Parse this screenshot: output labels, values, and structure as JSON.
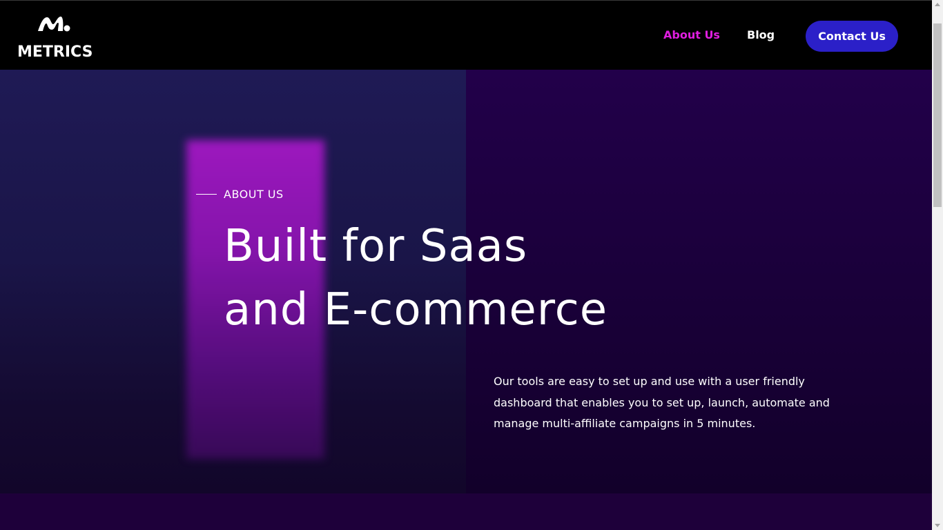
{
  "header": {
    "logo_text": "METRICS",
    "logo_icon": "metrics-logo-icon",
    "nav": {
      "about": "About Us",
      "blog": "Blog",
      "contact": "Contact Us"
    }
  },
  "hero": {
    "eyebrow": "ABOUT US",
    "headline_line1": "Built for Saas",
    "headline_line2": "and E-commerce",
    "description": "Our tools are easy to set up and use with a user friendly dashboard that enables you to set up, launch, automate and manage multi-affiliate campaigns in 5 minutes."
  },
  "colors": {
    "accent_active": "#e01ee0",
    "button": "#2b20c8",
    "header_bg": "#000000",
    "hero_bg": "#1d0038",
    "glow": "#a418c4"
  }
}
